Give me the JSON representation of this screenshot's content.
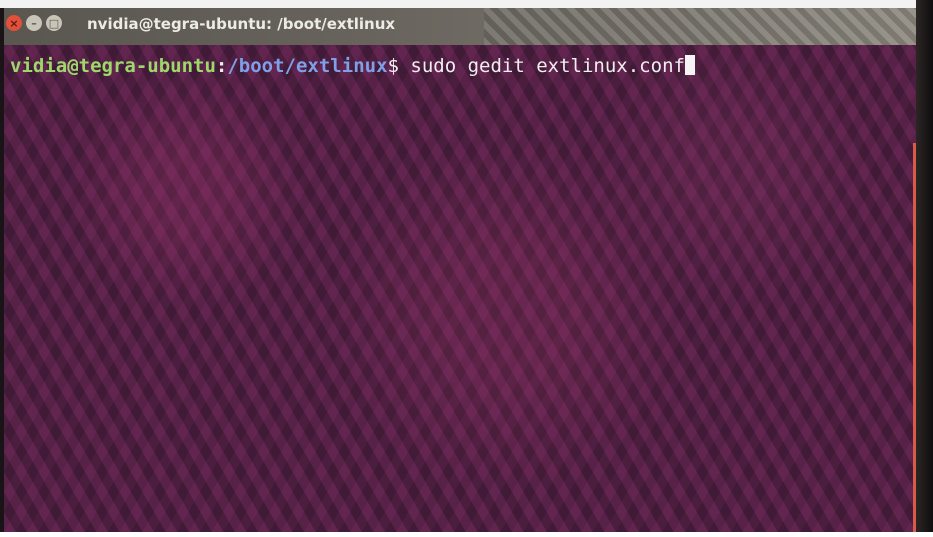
{
  "window": {
    "title": "nvidia@tegra-ubuntu: /boot/extlinux",
    "buttons": {
      "close_icon": "close-icon",
      "minimize_icon": "minimize-icon",
      "maximize_icon": "maximize-icon"
    }
  },
  "terminal": {
    "prompt_user_host": "vidia@tegra-ubuntu",
    "prompt_separator": ":",
    "prompt_path": "/boot/extlinux",
    "prompt_symbol": "$",
    "command": " sudo gedit extlinux.conf"
  },
  "colors": {
    "terminal_background": "#4a2140",
    "prompt_user_color": "#9fd86a",
    "prompt_path_color": "#7f9fe8",
    "close_button": "#e0503a",
    "titlebar": "#68645d"
  }
}
